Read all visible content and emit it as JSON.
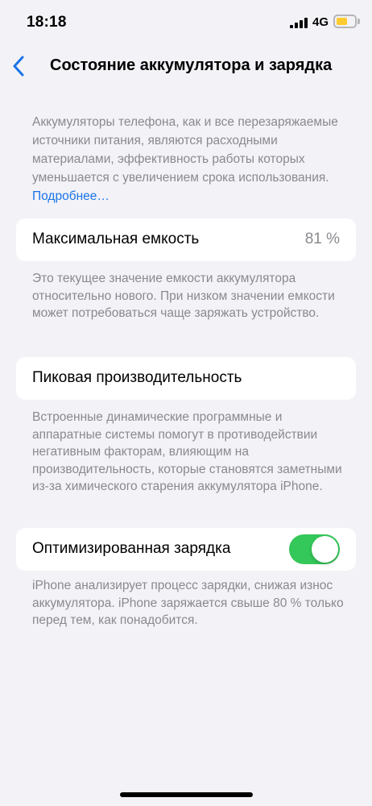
{
  "status_bar": {
    "time": "18:18",
    "network": "4G",
    "battery_level": 0.6,
    "battery_color": "#fecb2f"
  },
  "nav": {
    "back_icon": "chevron-left-icon",
    "title": "Состояние аккумулятора и зарядка"
  },
  "intro": {
    "text": "Аккумуляторы телефона, как и все перезаряжаемые источники питания, являются расходными материалами, эффективность работы которых уменьшается с увеличением срока использования. ",
    "link": "Подробнее…"
  },
  "max_capacity": {
    "label": "Максимальная емкость",
    "value": "81 %",
    "footnote": "Это текущее значение емкости аккумулятора относительно нового. При низком значении емкости может потребоваться чаще заряжать устройство."
  },
  "peak_performance": {
    "label": "Пиковая производительность",
    "footnote": "Встроенные динамические программные и аппаратные системы помогут в противодействии негативным факторам, влияющим на производительность, которые становятся заметными из-за химического старения аккумулятора iPhone."
  },
  "optimized_charging": {
    "label": "Оптимизированная зарядка",
    "enabled": true,
    "toggle_color": "#34c759",
    "footnote": "iPhone анализирует процесс зарядки, снижая износ аккумулятора. iPhone заряжается свыше 80 % только перед тем, как понадобится."
  },
  "colors": {
    "accent": "#1a74e8",
    "background": "#f2f2f7",
    "secondary_text": "#8a8a8e"
  }
}
